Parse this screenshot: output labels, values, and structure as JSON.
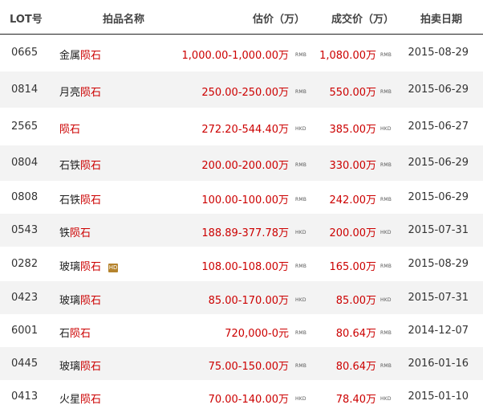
{
  "header": {
    "lot": "LOT号",
    "name": "拍品名称",
    "estimate": "估价（万）",
    "deal": "成交价（万）",
    "date": "拍卖日期"
  },
  "rows": [
    {
      "lot": "0665",
      "name_prefix": "金属",
      "name_kw": "陨石",
      "hd": "",
      "estimate": "1,000.00-1,000.00万",
      "est_cur": "RMB",
      "deal": "1,080.00万",
      "deal_cur": "RMB",
      "date": "2015-08-29"
    },
    {
      "lot": "0814",
      "name_prefix": "月亮",
      "name_kw": "陨石",
      "hd": "",
      "estimate": "250.00-250.00万",
      "est_cur": "RMB",
      "deal": "550.00万",
      "deal_cur": "RMB",
      "date": "2015-06-29"
    },
    {
      "lot": "2565",
      "name_prefix": "",
      "name_kw": "陨石",
      "hd": "",
      "estimate": "272.20-544.40万",
      "est_cur": "HKD",
      "deal": "385.00万",
      "deal_cur": "HKD",
      "date": "2015-06-27"
    },
    {
      "lot": "0804",
      "name_prefix": "石铁",
      "name_kw": "陨石",
      "hd": "",
      "estimate": "200.00-200.00万",
      "est_cur": "RMB",
      "deal": "330.00万",
      "deal_cur": "RMB",
      "date": "2015-06-29"
    },
    {
      "lot": "0808",
      "name_prefix": "石铁",
      "name_kw": "陨石",
      "hd": "",
      "estimate": "100.00-100.00万",
      "est_cur": "RMB",
      "deal": "242.00万",
      "deal_cur": "RMB",
      "date": "2015-06-29"
    },
    {
      "lot": "0543",
      "name_prefix": "铁",
      "name_kw": "陨石",
      "hd": "",
      "estimate": "188.89-377.78万",
      "est_cur": "HKD",
      "deal": "200.00万",
      "deal_cur": "HKD",
      "date": "2015-07-31"
    },
    {
      "lot": "0282",
      "name_prefix": "玻璃",
      "name_kw": "陨石",
      "hd": "HD",
      "estimate": "108.00-108.00万",
      "est_cur": "RMB",
      "deal": "165.00万",
      "deal_cur": "RMB",
      "date": "2015-08-29"
    },
    {
      "lot": "0423",
      "name_prefix": "玻璃",
      "name_kw": "陨石",
      "hd": "",
      "estimate": "85.00-170.00万",
      "est_cur": "HKD",
      "deal": "85.00万",
      "deal_cur": "HKD",
      "date": "2015-07-31"
    },
    {
      "lot": "6001",
      "name_prefix": "石",
      "name_kw": "陨石",
      "hd": "",
      "estimate": "720,000-0元",
      "est_cur": "RMB",
      "deal": "80.64万",
      "deal_cur": "RMB",
      "date": "2014-12-07"
    },
    {
      "lot": "0445",
      "name_prefix": "玻璃",
      "name_kw": "陨石",
      "hd": "",
      "estimate": "75.00-150.00万",
      "est_cur": "RMB",
      "deal": "80.64万",
      "deal_cur": "RMB",
      "date": "2016-01-16"
    },
    {
      "lot": "0413",
      "name_prefix": "火星",
      "name_kw": "陨石",
      "hd": "",
      "estimate": "70.00-140.00万",
      "est_cur": "HKD",
      "deal": "78.40万",
      "deal_cur": "HKD",
      "date": "2015-01-10"
    }
  ]
}
